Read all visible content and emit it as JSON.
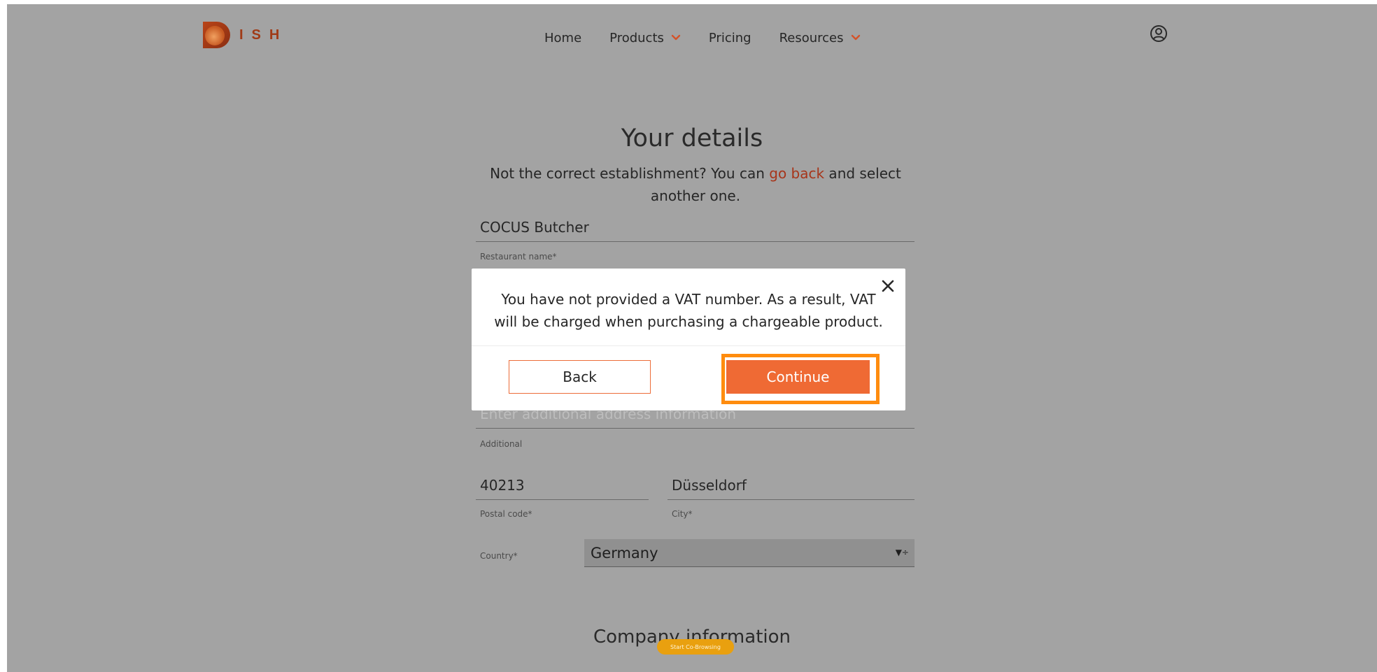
{
  "header": {
    "logo_text": "ISH",
    "nav": [
      {
        "label": "Home",
        "has_dropdown": false
      },
      {
        "label": "Products",
        "has_dropdown": true
      },
      {
        "label": "Pricing",
        "has_dropdown": false
      },
      {
        "label": "Resources",
        "has_dropdown": true
      }
    ],
    "user_icon": "user-circle-icon"
  },
  "page": {
    "title": "Your details",
    "subtitle_before": "Not the correct establishment? You can ",
    "subtitle_link": "go back",
    "subtitle_after": " and select another one.",
    "restaurant_name": {
      "value": "COCUS Butcher",
      "label": "Restaurant name*"
    },
    "additional": {
      "placeholder": "Enter additional address information",
      "label": "Additional"
    },
    "postal_code": {
      "value": "40213",
      "label": "Postal code*"
    },
    "city": {
      "value": "Düsseldorf",
      "label": "City*"
    },
    "country": {
      "label": "Country*",
      "value": "Germany"
    },
    "section_title": "Company information",
    "cobrowse_label": "Start Co-Browsing"
  },
  "modal": {
    "message": "You have not provided a VAT number. As a result, VAT will be charged when purchasing a chargeable product.",
    "back_label": "Back",
    "continue_label": "Continue"
  },
  "colors": {
    "overlay": "#a3a3a3",
    "accent": "#ef6a34",
    "focus": "#ff8c0e",
    "link": "#a7351a",
    "logo": "#a03b17"
  }
}
